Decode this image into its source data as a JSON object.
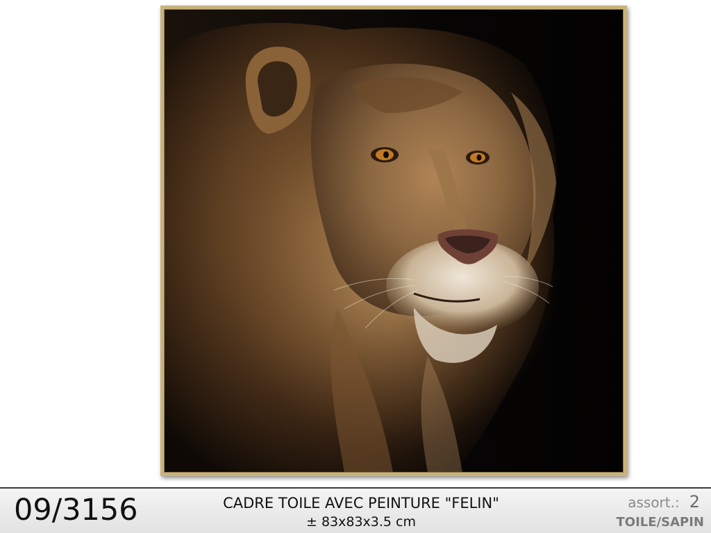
{
  "product": {
    "image_subject": "lion-portrait-canvas",
    "frame_color": "#c9b37c",
    "background_color": "#060403"
  },
  "info_bar": {
    "reference": "09/3156",
    "title": "CADRE TOILE AVEC PEINTURE \"FELIN\"",
    "dimensions": "± 83x83x3.5 cm",
    "assort_label": "assort.:",
    "assort_count": "2",
    "material": "TOILE/SAPIN"
  }
}
